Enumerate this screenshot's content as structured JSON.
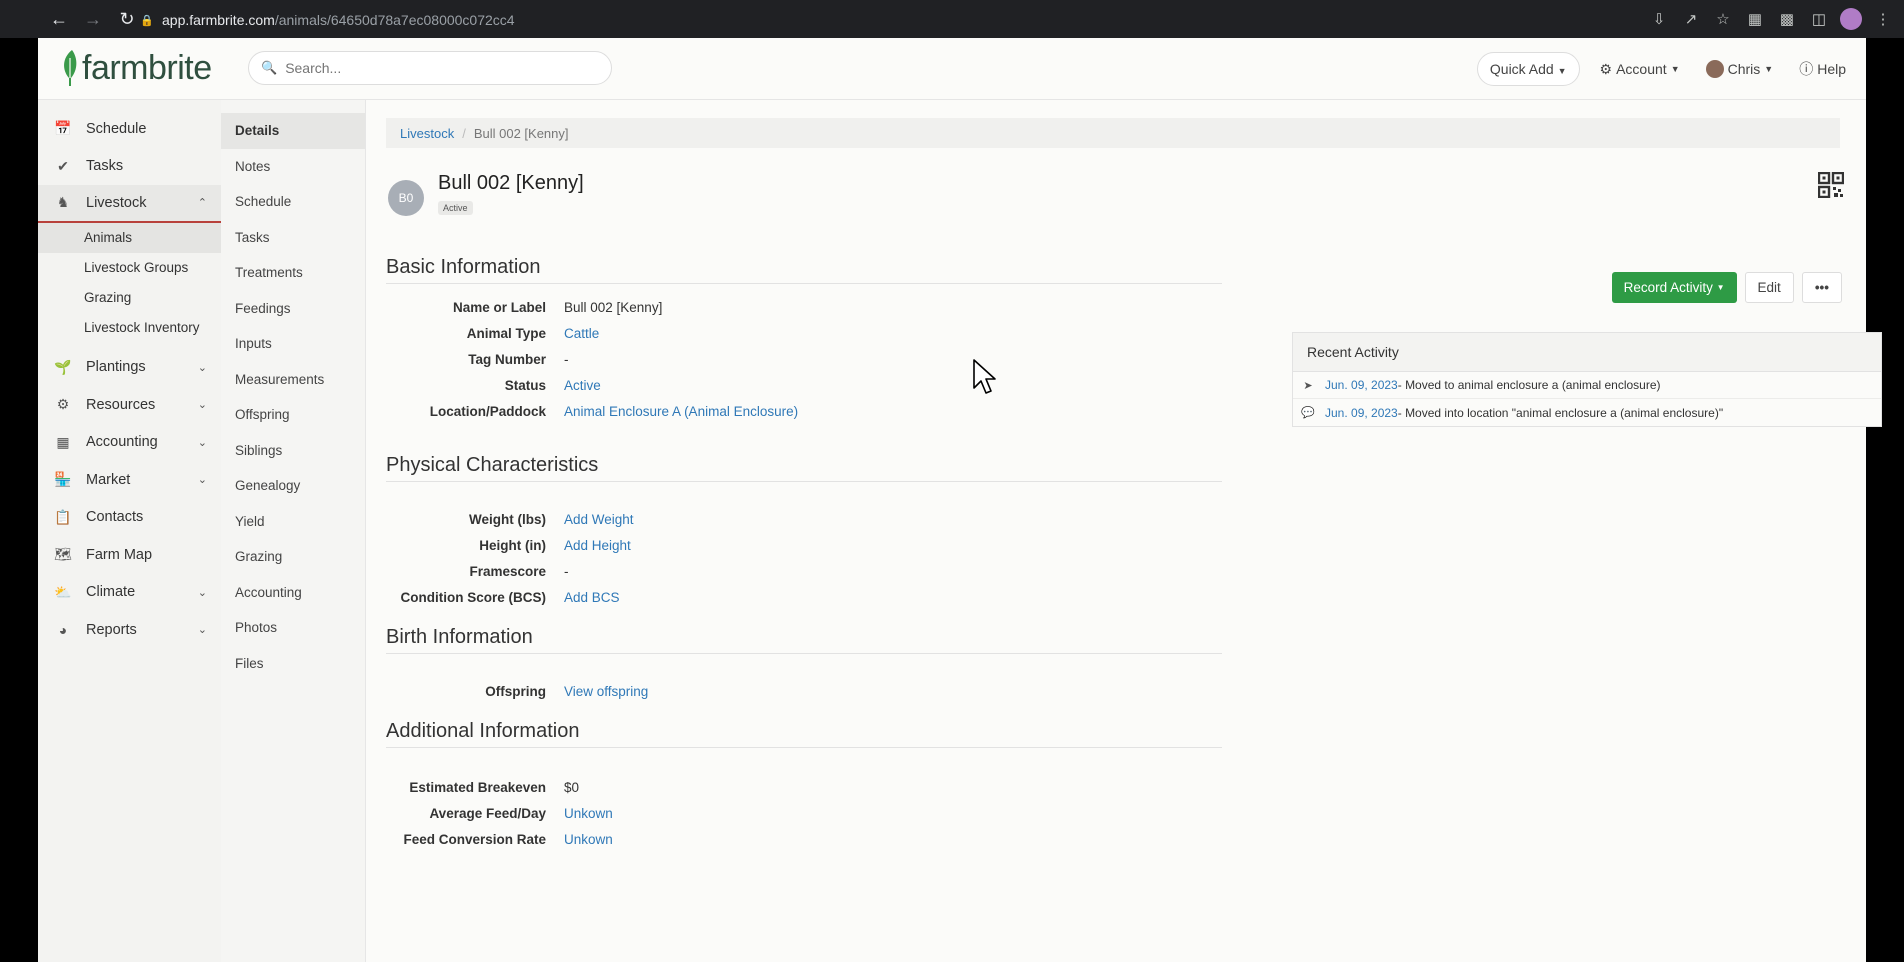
{
  "browser": {
    "url_host": "app.farmbrite.com",
    "url_path": "/animals/64650d78a7ec08000c072cc4"
  },
  "header": {
    "logo_text": "farmbrite",
    "search_placeholder": "Search...",
    "quick_add": "Quick Add",
    "account": "Account",
    "user": "Chris",
    "help": "Help"
  },
  "sidebar": {
    "items": [
      {
        "label": "Schedule",
        "icon": "calendar-icon"
      },
      {
        "label": "Tasks",
        "icon": "check-circle-icon"
      },
      {
        "label": "Livestock",
        "icon": "horse-icon"
      },
      {
        "label": "Plantings",
        "icon": "seedling-icon"
      },
      {
        "label": "Resources",
        "icon": "tractor-icon"
      },
      {
        "label": "Accounting",
        "icon": "calculator-icon"
      },
      {
        "label": "Market",
        "icon": "store-icon"
      },
      {
        "label": "Contacts",
        "icon": "address-book-icon"
      },
      {
        "label": "Farm Map",
        "icon": "map-icon"
      },
      {
        "label": "Climate",
        "icon": "cloud-sun-icon"
      },
      {
        "label": "Reports",
        "icon": "pie-chart-icon"
      }
    ],
    "livestock_sub": [
      "Animals",
      "Livestock Groups",
      "Grazing",
      "Livestock Inventory"
    ]
  },
  "subnav": [
    "Details",
    "Notes",
    "Schedule",
    "Tasks",
    "Treatments",
    "Feedings",
    "Inputs",
    "Measurements",
    "Offspring",
    "Siblings",
    "Genealogy",
    "Yield",
    "Grazing",
    "Accounting",
    "Photos",
    "Files"
  ],
  "breadcrumb": {
    "parent": "Livestock",
    "current": "Bull 002 [Kenny]"
  },
  "animal": {
    "initials": "B0",
    "title": "Bull 002 [Kenny]",
    "status_badge": "Active"
  },
  "actions": {
    "record_activity": "Record Activity",
    "edit": "Edit",
    "more": "•••"
  },
  "sections": {
    "basic": {
      "title": "Basic Information",
      "rows": [
        {
          "label": "Name or Label",
          "value": "Bull 002 [Kenny]"
        },
        {
          "label": "Animal Type",
          "value": "Cattle"
        },
        {
          "label": "Tag Number",
          "value": "-"
        },
        {
          "label": "Status",
          "value": "Active"
        },
        {
          "label": "Location/Paddock",
          "value": "Animal Enclosure A (Animal Enclosure)"
        }
      ]
    },
    "physical": {
      "title": "Physical Characteristics",
      "rows": [
        {
          "label": "Weight (lbs)",
          "value": "Add Weight"
        },
        {
          "label": "Height (in)",
          "value": "Add Height"
        },
        {
          "label": "Framescore",
          "value": "-"
        },
        {
          "label": "Condition Score (BCS)",
          "value": "Add BCS"
        }
      ]
    },
    "birth": {
      "title": "Birth Information",
      "rows": [
        {
          "label": "Offspring",
          "value": "View offspring"
        }
      ]
    },
    "additional": {
      "title": "Additional Information",
      "rows": [
        {
          "label": "Estimated Breakeven",
          "value": "$0"
        },
        {
          "label": "Average Feed/Day",
          "value": "Unkown"
        },
        {
          "label": "Feed Conversion Rate",
          "value": "Unkown"
        }
      ]
    }
  },
  "recent_activity": {
    "title": "Recent Activity",
    "items": [
      {
        "date": "Jun. 09, 2023",
        "text": " - Moved to animal enclosure a (animal enclosure)",
        "icon": "location-arrow-icon"
      },
      {
        "date": "Jun. 09, 2023",
        "text": " - Moved into location \"animal enclosure a (animal enclosure)\"",
        "icon": "comment-icon"
      }
    ]
  },
  "colors": {
    "brand_green": "#2e9b45",
    "link_blue": "#2f78b7",
    "active_accent": "#b8413b"
  }
}
